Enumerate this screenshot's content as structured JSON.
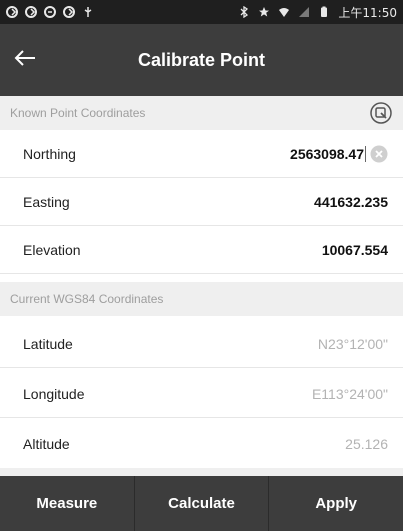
{
  "status_bar": {
    "time": "上午11:50",
    "icons": [
      "sync-icon",
      "sync-icon",
      "sync-icon",
      "sync-icon",
      "usb-icon",
      "bluetooth-icon",
      "star-icon",
      "wifi-icon",
      "no-signal-icon",
      "battery-icon"
    ]
  },
  "header": {
    "title": "Calibrate Point",
    "back_icon": "arrow-left-icon"
  },
  "known_point": {
    "section_title": "Known Point Coordinates",
    "action_icon": "select-point-icon",
    "fields": [
      {
        "label": "Northing",
        "value": "2563098.47"
      },
      {
        "label": "Easting",
        "value": "441632.235"
      },
      {
        "label": "Elevation",
        "value": "10067.554"
      }
    ]
  },
  "current_wgs84": {
    "section_title": "Current WGS84 Coordinates",
    "fields": [
      {
        "label": "Latitude",
        "value": "N23°12'00\""
      },
      {
        "label": "Longitude",
        "value": "E113°24'00\""
      },
      {
        "label": "Altitude",
        "value": "25.126"
      }
    ]
  },
  "bottom_bar": {
    "measure_label": "Measure",
    "calculate_label": "Calculate",
    "apply_label": "Apply"
  },
  "colors": {
    "app_bar": "#3d3d3d",
    "status_bar": "#1f1f1f",
    "section_bg": "#efefef",
    "muted_text": "#b3b3b3"
  }
}
